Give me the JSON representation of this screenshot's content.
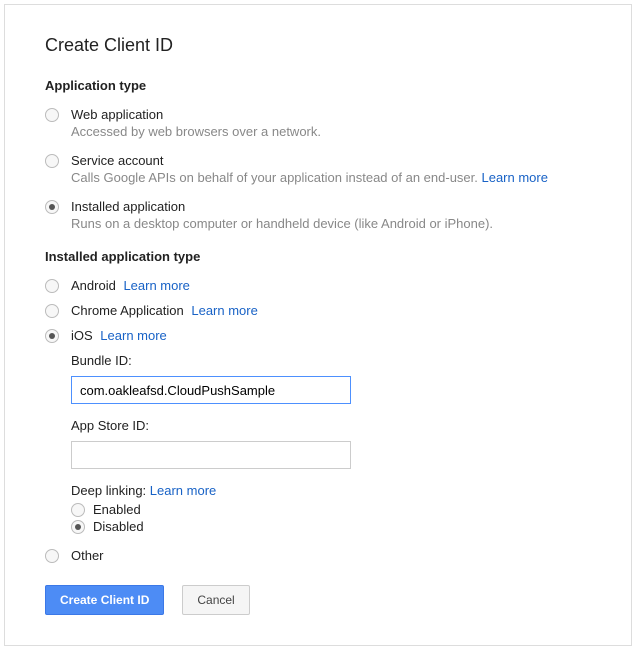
{
  "dialog": {
    "title": "Create Client ID"
  },
  "sections": {
    "app_type_heading": "Application type",
    "installed_type_heading": "Installed application type"
  },
  "app_type": {
    "web": {
      "label": "Web application",
      "desc": "Accessed by web browsers over a network."
    },
    "service": {
      "label": "Service account",
      "desc": "Calls Google APIs on behalf of your application instead of an end-user. ",
      "learn_more": "Learn more"
    },
    "installed": {
      "label": "Installed application",
      "desc": "Runs on a desktop computer or handheld device (like Android or iPhone)."
    }
  },
  "installed_type": {
    "android": {
      "label": "Android",
      "learn_more": "Learn more"
    },
    "chrome": {
      "label": "Chrome Application",
      "learn_more": "Learn more"
    },
    "ios": {
      "label": "iOS",
      "learn_more": "Learn more"
    },
    "other": {
      "label": "Other"
    }
  },
  "ios_fields": {
    "bundle_label": "Bundle ID:",
    "bundle_value": "com.oakleafsd.CloudPushSample",
    "appstore_label": "App Store ID:",
    "appstore_value": "",
    "deep_linking_label": "Deep linking: ",
    "deep_linking_learn_more": "Learn more",
    "enabled": "Enabled",
    "disabled": "Disabled"
  },
  "buttons": {
    "create": "Create Client ID",
    "cancel": "Cancel"
  }
}
